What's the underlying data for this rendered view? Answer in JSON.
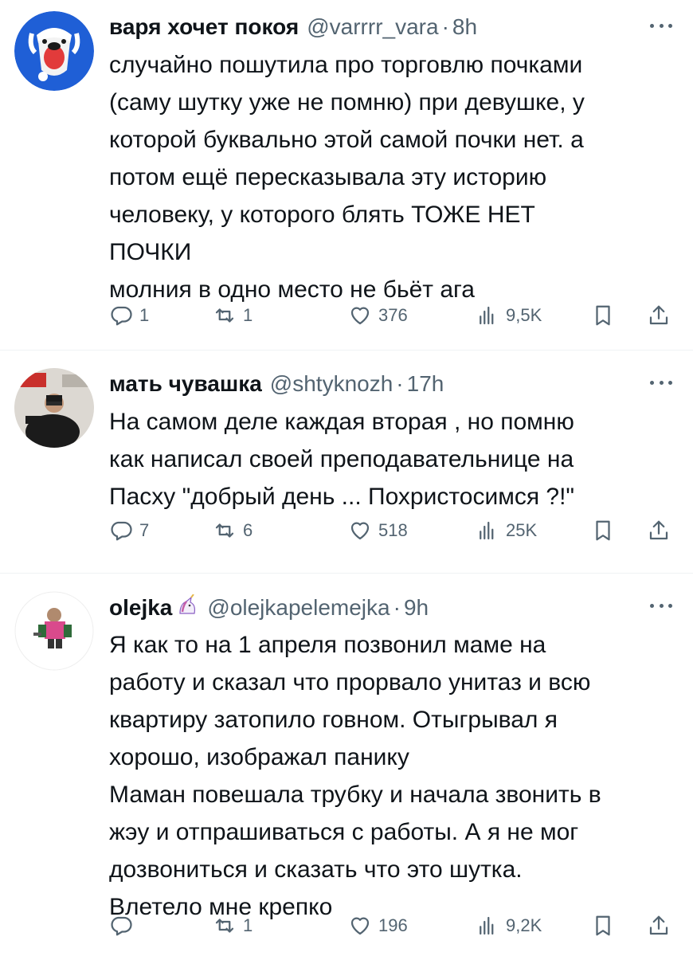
{
  "tweets": [
    {
      "name": "варя хочет покоя",
      "handle": "@varrrr_vara",
      "dot": "·",
      "time": "8h",
      "text": "случайно пошутила про торговлю почками\n(саму шутку уже не помню) при девушке, у\nкоторой буквально этой самой почки нет. а\nпотом ещё пересказывала эту историю\nчеловеку, у которого блять ТОЖЕ НЕТ\nПОЧКИ\nмолния в одно место не бьёт ага",
      "replies": "1",
      "retweets": "1",
      "likes": "376",
      "views": "9,5K",
      "avatar_icon": "dog-avatar",
      "avatar_bg": "#1f5fd6"
    },
    {
      "name": "мать чувашка",
      "handle": "@shtyknozh",
      "dot": "·",
      "time": "17h",
      "text": "На самом деле каждая вторая , но помню\nкак написал своей преподавательнице на\nПасху \"добрый день ... Похристосимся ?!\"",
      "replies": "7",
      "retweets": "6",
      "likes": "518",
      "views": "25K",
      "avatar_icon": "person-photo-avatar",
      "avatar_bg": "#d9d6d0"
    },
    {
      "name": "olejka",
      "name_emoji": "unicorn-emoji",
      "handle": "@olejkapelemejka",
      "dot": "·",
      "time": "9h",
      "text": "Я как то на 1 апреля позвонил маме на\nработу и сказал что прорвало унитаз и всю\nквартиру затопило говном. Отыгрывал я\nхорошо, изображал панику\nМаман повешала трубку и начала звонить в\nжэу и отпрашиваться с работы. А я не мог\nдозвониться и сказать что это шутка.\nВлетело мне крепко",
      "replies": "",
      "retweets": "1",
      "likes": "196",
      "views": "9,2K",
      "avatar_icon": "drawing-avatar",
      "avatar_bg": "#ffffff"
    }
  ],
  "colors": {
    "text": "#0f1419",
    "secondary": "#536471",
    "divider": "#eff3f4"
  }
}
